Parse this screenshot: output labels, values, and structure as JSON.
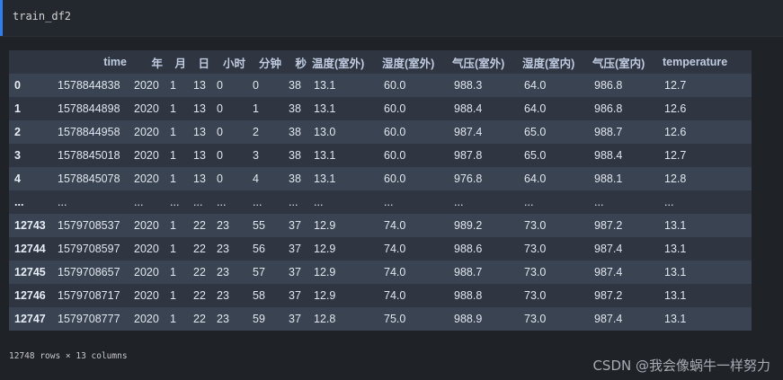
{
  "cell": {
    "code": "train_df2"
  },
  "dataframe": {
    "index_header": "",
    "columns": [
      "time",
      "年",
      "月",
      "日",
      "小时",
      "分钟",
      "秒",
      "温度(室外)",
      "湿度(室外)",
      "气压(室外)",
      "湿度(室内)",
      "气压(室内)",
      "temperature"
    ],
    "rows": [
      {
        "index": "0",
        "cells": [
          "1578844838",
          "2020",
          "1",
          "13",
          "0",
          "0",
          "38",
          "13.1",
          "60.0",
          "988.3",
          "64.0",
          "986.8",
          "12.7"
        ]
      },
      {
        "index": "1",
        "cells": [
          "1578844898",
          "2020",
          "1",
          "13",
          "0",
          "1",
          "38",
          "13.1",
          "60.0",
          "988.4",
          "64.0",
          "986.8",
          "12.6"
        ]
      },
      {
        "index": "2",
        "cells": [
          "1578844958",
          "2020",
          "1",
          "13",
          "0",
          "2",
          "38",
          "13.0",
          "60.0",
          "987.4",
          "65.0",
          "988.7",
          "12.6"
        ]
      },
      {
        "index": "3",
        "cells": [
          "1578845018",
          "2020",
          "1",
          "13",
          "0",
          "3",
          "38",
          "13.1",
          "60.0",
          "987.8",
          "65.0",
          "988.4",
          "12.7"
        ]
      },
      {
        "index": "4",
        "cells": [
          "1578845078",
          "2020",
          "1",
          "13",
          "0",
          "4",
          "38",
          "13.1",
          "60.0",
          "976.8",
          "64.0",
          "988.1",
          "12.8"
        ]
      },
      {
        "index": "...",
        "cells": [
          "...",
          "...",
          "...",
          "...",
          "...",
          "...",
          "...",
          "...",
          "...",
          "...",
          "...",
          "...",
          "..."
        ]
      },
      {
        "index": "12743",
        "cells": [
          "1579708537",
          "2020",
          "1",
          "22",
          "23",
          "55",
          "37",
          "12.9",
          "74.0",
          "989.2",
          "73.0",
          "987.2",
          "13.1"
        ]
      },
      {
        "index": "12744",
        "cells": [
          "1579708597",
          "2020",
          "1",
          "22",
          "23",
          "56",
          "37",
          "12.9",
          "74.0",
          "988.6",
          "73.0",
          "987.4",
          "13.1"
        ]
      },
      {
        "index": "12745",
        "cells": [
          "1579708657",
          "2020",
          "1",
          "22",
          "23",
          "57",
          "37",
          "12.9",
          "74.0",
          "988.7",
          "73.0",
          "987.4",
          "13.1"
        ]
      },
      {
        "index": "12746",
        "cells": [
          "1579708717",
          "2020",
          "1",
          "22",
          "23",
          "58",
          "37",
          "12.9",
          "74.0",
          "988.8",
          "73.0",
          "987.2",
          "13.1"
        ]
      },
      {
        "index": "12747",
        "cells": [
          "1579708777",
          "2020",
          "1",
          "22",
          "23",
          "59",
          "37",
          "12.8",
          "75.0",
          "988.9",
          "73.0",
          "987.4",
          "13.1"
        ]
      }
    ],
    "shape_text": "12748 rows × 13 columns"
  },
  "watermark": "CSDN @我会像蜗牛一样努力"
}
